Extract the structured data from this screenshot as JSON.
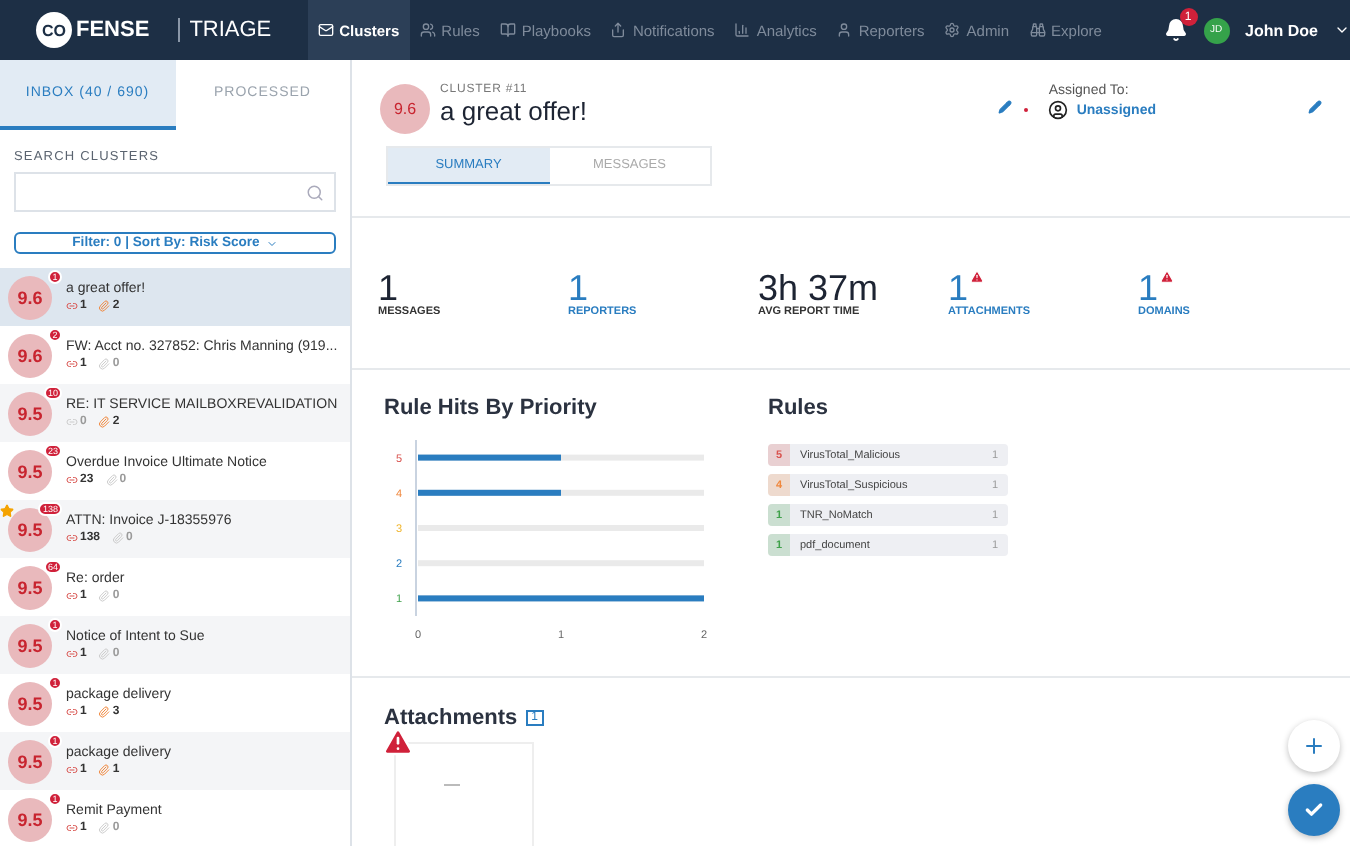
{
  "nav": {
    "brand": "CO",
    "brand_rest": "FENSE",
    "product": "TRIAGE",
    "items": [
      {
        "label": "Clusters",
        "selected": true
      },
      {
        "label": "Rules",
        "selected": false
      },
      {
        "label": "Playbooks",
        "selected": false
      },
      {
        "label": "Notifications",
        "selected": false
      },
      {
        "label": "Analytics",
        "selected": false
      },
      {
        "label": "Reporters",
        "selected": false
      },
      {
        "label": "Admin",
        "selected": false
      },
      {
        "label": "Explore",
        "selected": false
      }
    ],
    "notification_count": "1",
    "user_initials": "JD",
    "user_name": "John Doe"
  },
  "sidebar": {
    "tabs": [
      {
        "label": "INBOX (40 / 690)",
        "selected": true
      },
      {
        "label": "PROCESSED",
        "selected": false
      }
    ],
    "search_label": "SEARCH CLUSTERS",
    "filter": "Filter: 0 | Sort By: Risk Score",
    "clusters": [
      {
        "score": "9.6",
        "badge": "1",
        "title": "a great offer!",
        "starred": false,
        "selected": true,
        "counts": [
          {
            "value": "1",
            "active": true
          },
          {
            "value": "2",
            "active": true
          }
        ]
      },
      {
        "score": "9.6",
        "badge": "2",
        "title": "FW: Acct no. 327852: Chris Manning (919...",
        "starred": false,
        "selected": false,
        "counts": [
          {
            "value": "1",
            "active": true
          },
          {
            "value": "0",
            "active": false
          }
        ]
      },
      {
        "score": "9.5",
        "badge": "10",
        "title": "RE: IT SERVICE MAILBOXREVALIDATION",
        "starred": false,
        "selected": false,
        "counts": [
          {
            "value": "0",
            "active": false
          },
          {
            "value": "2",
            "active": true
          }
        ]
      },
      {
        "score": "9.5",
        "badge": "23",
        "title": "Overdue Invoice Ultimate Notice",
        "starred": false,
        "selected": false,
        "counts": [
          {
            "value": "23",
            "active": true
          },
          {
            "value": "0",
            "active": false
          }
        ]
      },
      {
        "score": "9.5",
        "badge": "138",
        "title": "ATTN: Invoice J-18355976",
        "starred": true,
        "selected": false,
        "counts": [
          {
            "value": "138",
            "active": true
          },
          {
            "value": "0",
            "active": false
          }
        ]
      },
      {
        "score": "9.5",
        "badge": "64",
        "title": "Re: order",
        "starred": false,
        "selected": false,
        "counts": [
          {
            "value": "1",
            "active": true
          },
          {
            "value": "0",
            "active": false
          }
        ]
      },
      {
        "score": "9.5",
        "badge": "1",
        "title": "Notice of Intent to Sue",
        "starred": false,
        "selected": false,
        "counts": [
          {
            "value": "1",
            "active": true
          },
          {
            "value": "0",
            "active": false
          }
        ]
      },
      {
        "score": "9.5",
        "badge": "1",
        "title": "package delivery",
        "starred": false,
        "selected": false,
        "counts": [
          {
            "value": "1",
            "active": true
          },
          {
            "value": "3",
            "active": true
          }
        ]
      },
      {
        "score": "9.5",
        "badge": "1",
        "title": "package delivery",
        "starred": false,
        "selected": false,
        "counts": [
          {
            "value": "1",
            "active": true
          },
          {
            "value": "1",
            "active": true
          }
        ]
      },
      {
        "score": "9.5",
        "badge": "1",
        "title": "Remit Payment",
        "starred": false,
        "selected": false,
        "counts": [
          {
            "value": "1",
            "active": true
          },
          {
            "value": "0",
            "active": false
          }
        ]
      }
    ]
  },
  "cluster": {
    "score": "9.6",
    "label": "CLUSTER #11",
    "title": "a great offer!",
    "assigned_label": "Assigned To:",
    "assignee": "Unassigned",
    "tabs": [
      {
        "label": "SUMMARY",
        "selected": true
      },
      {
        "label": "MESSAGES",
        "selected": false
      }
    ]
  },
  "stats": [
    {
      "value": "1",
      "label": "MESSAGES",
      "link": false,
      "alert": false
    },
    {
      "value": "1",
      "label": "REPORTERS",
      "link": true,
      "alert": false
    },
    {
      "value": "3h 37m",
      "label": "AVG REPORT TIME",
      "link": false,
      "alert": false
    },
    {
      "value": "1",
      "label": "ATTACHMENTS",
      "link": true,
      "alert": true
    },
    {
      "value": "1",
      "label": "DOMAINS",
      "link": true,
      "alert": true
    }
  ],
  "rule_hits": {
    "title": "Rule Hits By Priority",
    "chart_data": {
      "type": "bar",
      "orientation": "horizontal",
      "categories": [
        "5",
        "4",
        "3",
        "2",
        "1"
      ],
      "values": [
        1,
        1,
        0,
        0,
        2
      ],
      "xlim": [
        0,
        2
      ],
      "xticks": [
        0,
        1,
        2
      ]
    }
  },
  "rules": {
    "title": "Rules",
    "items": [
      {
        "priority": "5",
        "color": "#d9534f",
        "name": "VirusTotal_Malicious",
        "count": "1"
      },
      {
        "priority": "4",
        "color": "#f0883e",
        "name": "VirusTotal_Suspicious",
        "count": "1"
      },
      {
        "priority": "1",
        "color": "#3fa14a",
        "name": "TNR_NoMatch",
        "count": "1"
      },
      {
        "priority": "1",
        "color": "#3fa14a",
        "name": "pdf_document",
        "count": "1"
      }
    ]
  },
  "attachments": {
    "title": "Attachments",
    "count": "1",
    "alert": true
  }
}
